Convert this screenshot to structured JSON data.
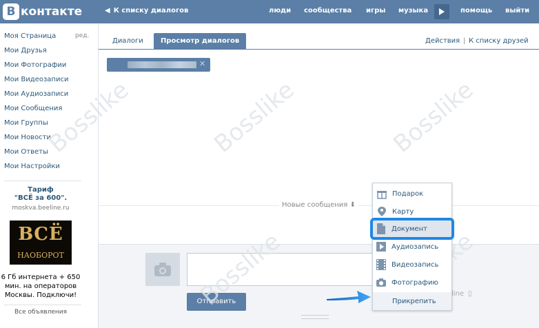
{
  "header": {
    "logo_text": "контакте",
    "logo_mark": "В",
    "back_link": "К списку диалогов",
    "nav": [
      "люди",
      "сообщества",
      "игры",
      "музыка",
      "помощь",
      "выйти"
    ]
  },
  "sidebar": {
    "items": [
      "Моя Страница",
      "Мои Друзья",
      "Мои Фотографии",
      "Мои Видеозаписи",
      "Мои Аудиозаписи",
      "Мои Сообщения",
      "Мои Группы",
      "Мои Новости",
      "Мои Ответы",
      "Мои Настройки"
    ],
    "edit_label": "ред.",
    "ad": {
      "title_line1": "Тариф",
      "title_line2": "\"ВСЁ за 600\".",
      "domain": "moskva.beeline.ru",
      "image_big": "ВСЁ",
      "image_small": "НАОБОРОТ",
      "text": "6 Гб интернета + 650 мин. на операторов Москвы. Подключи!"
    },
    "ads_all": "Все объявления"
  },
  "main": {
    "tabs": [
      "Диалоги",
      "Просмотр диалогов"
    ],
    "actions_link": "Действия",
    "separator": "|",
    "friends_link": "К списку друзей",
    "new_messages_label": "Новые сообщения",
    "send_button": "Отправить",
    "online_label": "line"
  },
  "attach_menu": {
    "items": [
      {
        "label": "Подарок",
        "icon": "gift-icon"
      },
      {
        "label": "Карту",
        "icon": "map-pin-icon"
      },
      {
        "label": "Документ",
        "icon": "document-icon"
      },
      {
        "label": "Аудиозапись",
        "icon": "audio-icon"
      },
      {
        "label": "Видеозапись",
        "icon": "video-icon"
      },
      {
        "label": "Фотографию",
        "icon": "camera-icon"
      }
    ],
    "attach_label": "Прикрепить"
  },
  "watermark": "Bosslike",
  "colors": {
    "brand": "#5b7fa6",
    "link": "#2b587a",
    "highlight": "#1e88e5"
  }
}
